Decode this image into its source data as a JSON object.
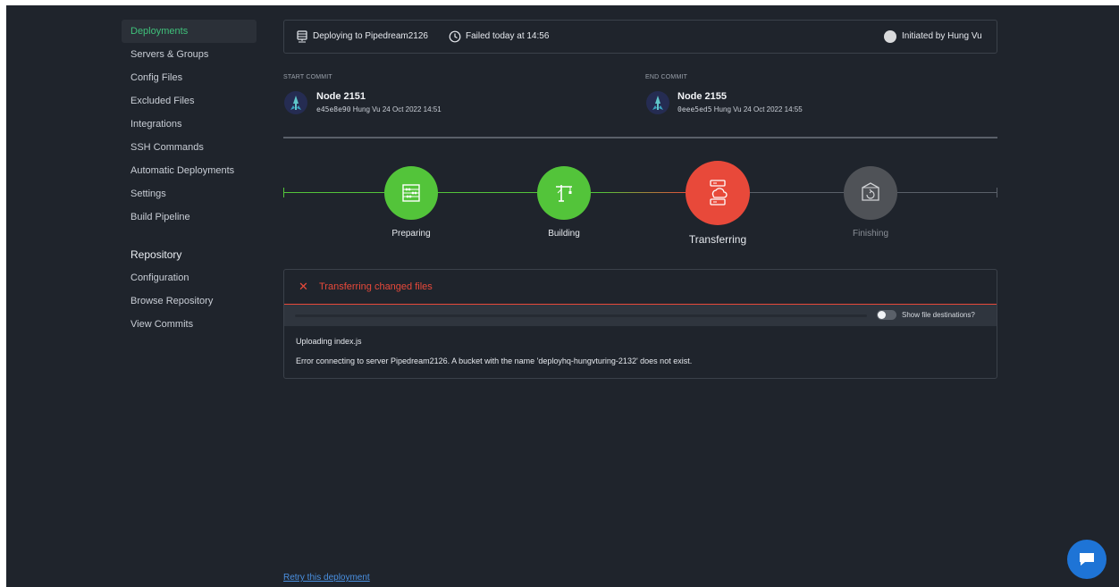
{
  "sidebar": {
    "items": [
      {
        "label": "Deployments",
        "active": true
      },
      {
        "label": "Servers & Groups"
      },
      {
        "label": "Config Files"
      },
      {
        "label": "Excluded Files"
      },
      {
        "label": "Integrations"
      },
      {
        "label": "SSH Commands"
      },
      {
        "label": "Automatic Deployments"
      },
      {
        "label": "Settings"
      },
      {
        "label": "Build Pipeline"
      }
    ],
    "repository_heading": "Repository",
    "repository_items": [
      {
        "label": "Configuration"
      },
      {
        "label": "Browse Repository"
      },
      {
        "label": "View Commits"
      }
    ]
  },
  "header": {
    "deploying_text": "Deploying to Pipedream2126",
    "status_text": "Failed today at 14:56",
    "initiated_text": "Initiated by Hung Vu",
    "icons": {
      "server": "server-icon",
      "clock": "clock-icon",
      "user": "user-avatar"
    }
  },
  "commits": {
    "start": {
      "label": "START COMMIT",
      "title": "Node 2151",
      "hash": "e45e8e90",
      "author": "Hung Vu",
      "date": "24 Oct 2022 14:51"
    },
    "end": {
      "label": "END COMMIT",
      "title": "Node 2155",
      "hash": "0eee5ed5",
      "author": "Hung Vu",
      "date": "24 Oct 2022 14:55"
    }
  },
  "pipeline": {
    "stages": [
      {
        "label": "Preparing",
        "status": "done",
        "icon": "abacus-icon"
      },
      {
        "label": "Building",
        "status": "done",
        "icon": "crane-icon"
      },
      {
        "label": "Transferring",
        "status": "failed",
        "icon": "cloud-server-icon"
      },
      {
        "label": "Finishing",
        "status": "pending",
        "icon": "box-icon"
      }
    ]
  },
  "log": {
    "title": "Transferring changed files",
    "toggle_label": "Show file destinations?",
    "toggle_on": false,
    "lines": [
      "Uploading index.js",
      "Error connecting to server Pipedream2126. A bucket with the name 'deployhq-hungvturing-2132' does not exist."
    ]
  },
  "retry_link": "Retry this deployment",
  "colors": {
    "background": "#1f242c",
    "accent_green": "#3fc07a",
    "success": "#53c43a",
    "error": "#e8493a",
    "pending": "#4f5257",
    "link": "#4a90e2"
  }
}
